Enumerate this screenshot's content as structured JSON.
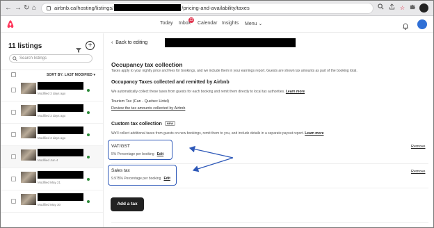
{
  "browser": {
    "url_prefix": "airbnb.ca/hosting/listings/",
    "url_suffix": "/pricing-and-availability/taxes",
    "back_glyph": "←",
    "forward_glyph": "→",
    "reload_glyph": "↻",
    "home_glyph": "⌂"
  },
  "header": {
    "logo": "airbnb-logo",
    "nav": [
      "Today",
      "Inbox",
      "Calendar",
      "Insights",
      "Menu"
    ],
    "inbox_badge": "13",
    "menu_chevron": "⌄"
  },
  "sidebar": {
    "title": "11 listings",
    "add_glyph": "+",
    "search_placeholder": "Search listings",
    "sort_label": "SORT BY: LAST MODIFIED",
    "sort_chevron": "▾",
    "rows": [
      {
        "modified": "Modified 2 days ago",
        "active": true
      },
      {
        "modified": "Modified 2 days ago",
        "active": true
      },
      {
        "modified": "Modified 2 days ago",
        "active": true
      },
      {
        "modified": "Modified Jun 4",
        "active": true
      },
      {
        "modified": "Modified May 21",
        "active": true
      },
      {
        "modified": "Modified May 30",
        "active": true
      }
    ]
  },
  "main": {
    "back_label": "Back to editing",
    "section_title": "Occupancy tax collection",
    "section_desc": "Taxes apply to your nightly price and fees for bookings, and we include them in your earnings report. Guests are shown tax amounts as part of the booking total.",
    "remitted_title": "Occupancy Taxes collected and remitted by Airbnb",
    "remitted_desc": "We automatically collect these taxes from guests for each booking and remit them directly to local tax authorities.",
    "learn_more": "Learn more",
    "remitted_item": "Tourism Tax (Can - Quebec Hotel)",
    "review_link": "Review the tax amounts collected by Airbnb",
    "custom_title": "Custom tax collection",
    "new_tag": "NEW",
    "custom_desc": "We'll collect additional taxes from guests on new bookings, remit them to you, and include details in a separate payout report.",
    "custom_learn_more": "Learn more",
    "taxes": [
      {
        "name": "VAT/GST",
        "detail": "5% Percentage per booking",
        "edit": "Edit",
        "remove": "Remove"
      },
      {
        "name": "Sales tax",
        "detail": "9.975% Percentage per booking",
        "edit": "Edit",
        "remove": "Remove"
      }
    ],
    "add_tax_label": "Add a tax"
  },
  "colors": {
    "highlight": "#2d58b8",
    "brand": "#ff385c",
    "active_dot": "#2e8b3a"
  }
}
